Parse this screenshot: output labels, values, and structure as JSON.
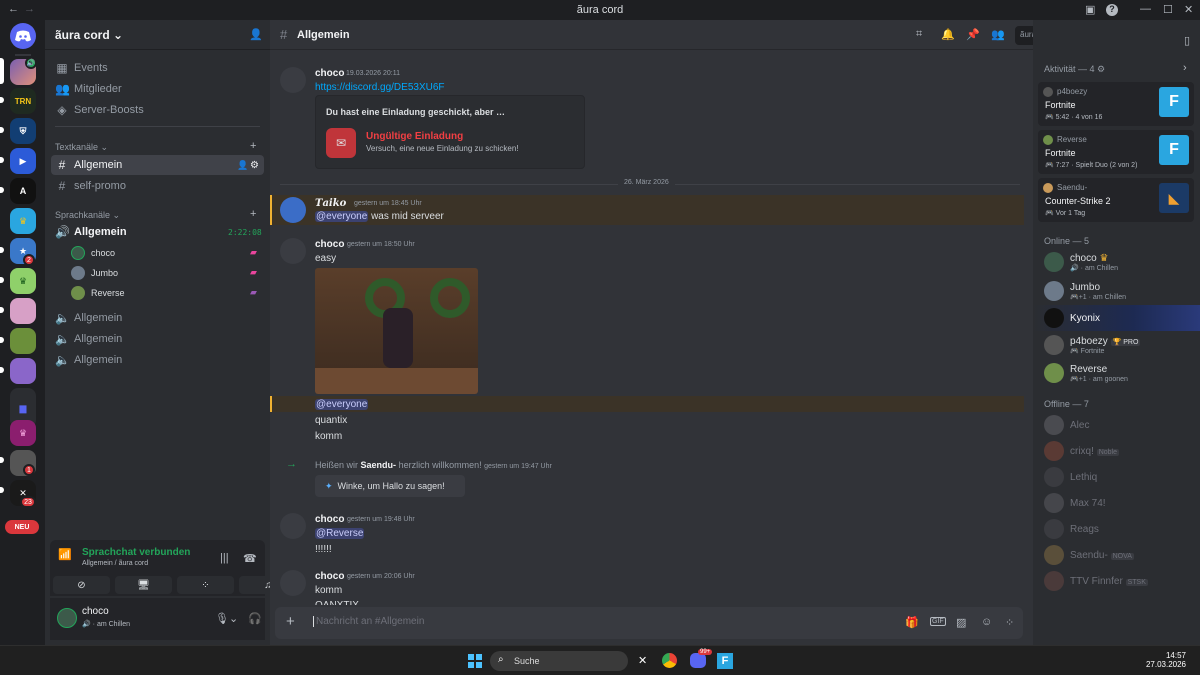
{
  "window": {
    "title": "ãura cord"
  },
  "server": {
    "name": "ãura cord"
  },
  "nav": {
    "events": "Events",
    "members": "Mitglieder",
    "boosts": "Server-Boosts"
  },
  "text_category": "Textkanäle",
  "text_channels": [
    "Allgemein",
    "self-promo"
  ],
  "voice_category": "Sprachkanäle",
  "voice_channels": [
    {
      "name": "Allgemein",
      "timer": "2:22:08"
    },
    {
      "name": "Allgemein"
    },
    {
      "name": "Allgemein"
    },
    {
      "name": "Allgemein"
    }
  ],
  "voice_users": [
    "choco",
    "Jumbo",
    "Reverse"
  ],
  "guild_badges": {
    "g2": "2",
    "g13": "1",
    "g14": "23",
    "new": "NEU"
  },
  "voice_panel": {
    "status": "Sprachchat verbunden",
    "location": "Allgemein / ãura cord"
  },
  "user_panel": {
    "name": "choco",
    "status": "am Chillen"
  },
  "chat_header": {
    "channel": "Allgemein",
    "search_placeholder": "ãura cord suchen"
  },
  "messages": {
    "m1": {
      "author": "choco",
      "time": "19.03.2026 20:11",
      "link": "https://discord.gg/DE53XU6F"
    },
    "invite": {
      "heading": "Du hast eine Einladung geschickt, aber …",
      "title": "Ungültige Einladung",
      "sub": "Versuch, eine neue Einladung zu schicken!"
    },
    "divider": "26. März 2026",
    "m2": {
      "author": "𝑻𝒂𝒊𝒌𝒐",
      "time": "gestern um 18:45 Uhr",
      "mention": "@everyone",
      "text": "was mid serveer"
    },
    "m3": {
      "author": "choco",
      "time": "gestern um 18:50 Uhr",
      "text": "easy",
      "mention": "@everyone",
      "line2": "quantix",
      "line3": "komm"
    },
    "join": {
      "pre": "Heißen wir",
      "name": "Saendu-",
      "post": "herzlich willkommen!",
      "time": "gestern um 19:47 Uhr",
      "wave": "Winke, um Hallo zu sagen!"
    },
    "m4": {
      "author": "choco",
      "time": "gestern um 19:48 Uhr",
      "mention": "@Reverse",
      "text": "!!!!!!"
    },
    "m5": {
      "author": "choco",
      "time": "gestern um 20:06 Uhr",
      "text": "komm",
      "cut": "QANXTIX"
    }
  },
  "composer": {
    "placeholder": "Nachricht an #Allgemein"
  },
  "activity": {
    "header": "Aktivität — 4",
    "cards": [
      {
        "user": "p4boezy",
        "game": "Fortnite",
        "t": "5:42",
        "extra": "4 von 16"
      },
      {
        "user": "Reverse",
        "game": "Fortnite",
        "t": "7:27",
        "extra": "Spielt Duo (2 von 2)"
      },
      {
        "user": "Saendu-",
        "game": "Counter-Strike 2",
        "extra": "Vor 1 Tag"
      }
    ]
  },
  "online": {
    "header": "Online — 5",
    "members": [
      {
        "name": "choco",
        "status": "am Chillen"
      },
      {
        "name": "Jumbo",
        "status": "+1 · am Chillen"
      },
      {
        "name": "Kyonix",
        "status": ""
      },
      {
        "name": "p4boezy",
        "tag": "PRO",
        "status": "Fortnite"
      },
      {
        "name": "Reverse",
        "status": "+1 · am goonen"
      }
    ]
  },
  "offline": {
    "header": "Offline — 7",
    "members": [
      {
        "name": "Alec"
      },
      {
        "name": "crixq!",
        "tag": "Noble"
      },
      {
        "name": "Lethiq"
      },
      {
        "name": "Max 74!"
      },
      {
        "name": "Reags"
      },
      {
        "name": "Saendu-",
        "tag": "NOVA"
      },
      {
        "name": "TTV Finnfer",
        "tag": "STSK"
      }
    ]
  },
  "taskbar": {
    "search": "Suche",
    "time": "14:57",
    "date": "27.03.2026",
    "discord_badge": "99+"
  },
  "colors": {
    "accent": "#5865f2",
    "online": "#23a55a",
    "danger": "#da373c",
    "link": "#00a8fc"
  }
}
